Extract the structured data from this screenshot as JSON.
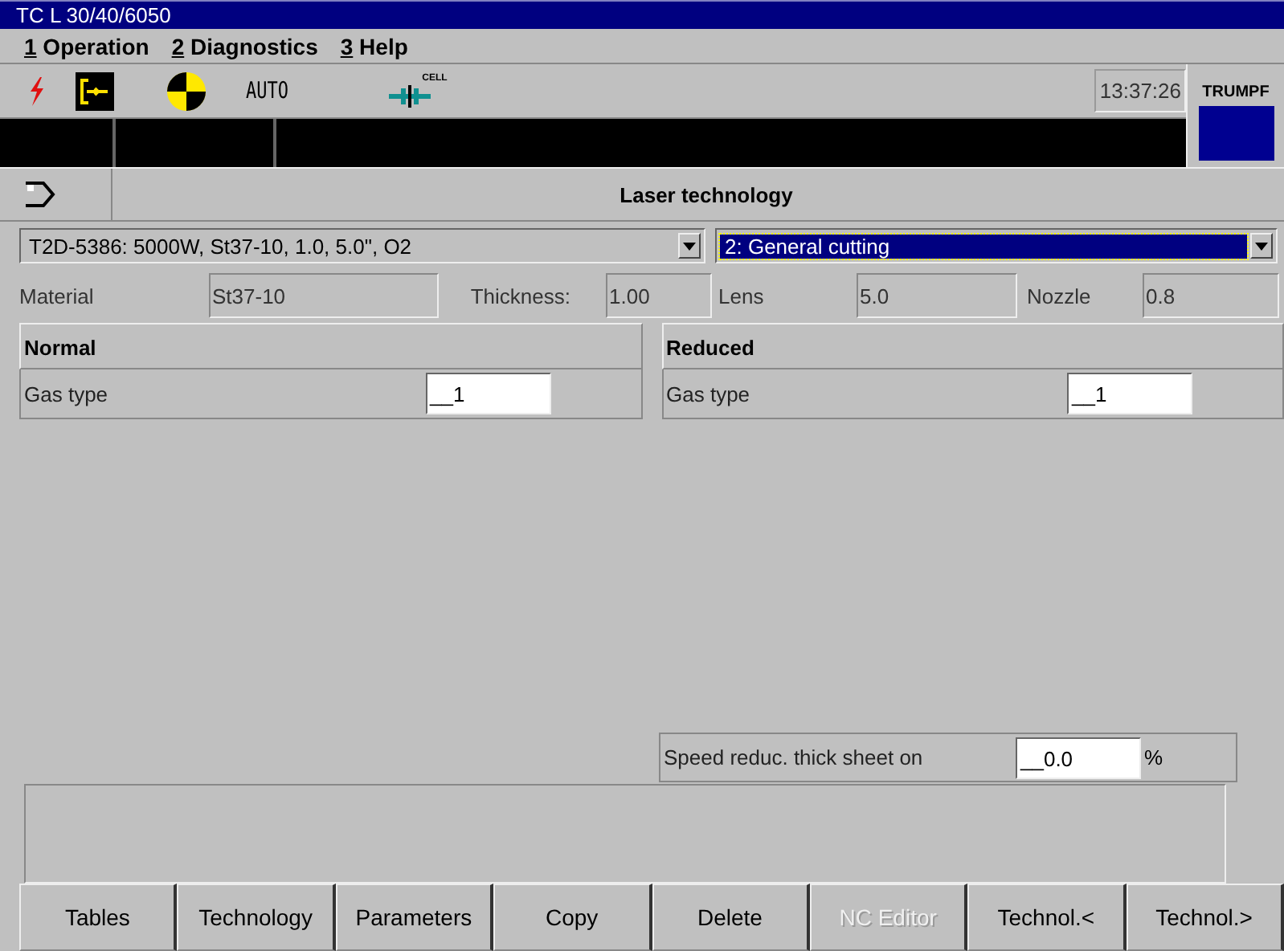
{
  "window": {
    "title": "TC L 30/40/6050"
  },
  "menu": [
    {
      "key": "1",
      "label": " Operation"
    },
    {
      "key": "2",
      "label": " Diagnostics"
    },
    {
      "key": "3",
      "label": " Help"
    }
  ],
  "status": {
    "mode": "AUTO",
    "cell_label": "CELL",
    "time": "13:37:26",
    "brand": "TRUMPF"
  },
  "header": {
    "title": "Laser technology"
  },
  "selectors": [
    {
      "value": "T2D-5386:  5000W,  St37-10,  1.0,  5.0\",  O2",
      "focused": false
    },
    {
      "value": "2: General cutting",
      "focused": true
    }
  ],
  "info": [
    {
      "label": "Material",
      "value": "St37-10"
    },
    {
      "label": "Thickness:",
      "value": "1.00"
    },
    {
      "label": "Lens",
      "value": "5.0"
    },
    {
      "label": "Nozzle",
      "value": "0.8"
    }
  ],
  "sections": [
    {
      "title": "Normal",
      "label": "Gas type",
      "value": "__1"
    },
    {
      "title": "Reduced",
      "label": "Gas type",
      "value": "__1"
    }
  ],
  "speed": {
    "label": "Speed reduc. thick sheet on",
    "value": "__0.0",
    "unit": "%"
  },
  "buttons": [
    {
      "label": "Tables",
      "disabled": false
    },
    {
      "label": "Technology",
      "disabled": false
    },
    {
      "label": "Parameters",
      "disabled": false
    },
    {
      "label": "Copy",
      "disabled": false
    },
    {
      "label": "Delete",
      "disabled": false
    },
    {
      "label": "NC Editor",
      "disabled": true
    },
    {
      "label": "Technol.<",
      "disabled": false
    },
    {
      "label": "Technol.>",
      "disabled": false
    }
  ]
}
